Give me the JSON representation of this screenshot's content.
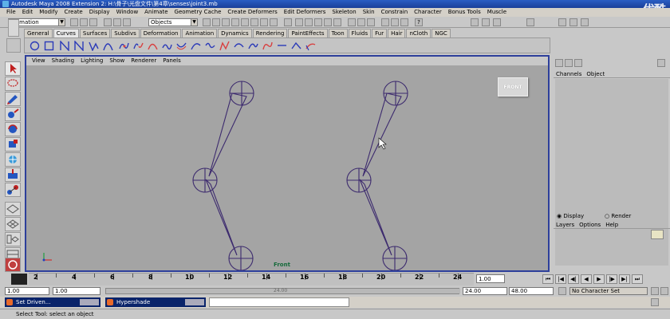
{
  "titlebar": {
    "title": "Autodesk Maya 2008 Extension 2: H:\\骨子\\光盘文件\\第4章\\senses\\joint3.mb",
    "logo": "优酷"
  },
  "menu": [
    "File",
    "Edit",
    "Modify",
    "Create",
    "Display",
    "Window",
    "Animate",
    "Geometry Cache",
    "Create Deformers",
    "Edit Deformers",
    "Skeleton",
    "Skin",
    "Constrain",
    "Character",
    "Bonus Tools",
    "Muscle"
  ],
  "statusline": {
    "mode": "Animation",
    "selection": "Objects"
  },
  "shelf_tabs": [
    "General",
    "Curves",
    "Surfaces",
    "Subdivs",
    "Deformation",
    "Animation",
    "Dynamics",
    "Rendering",
    "PaintEffects",
    "Toon",
    "Fluids",
    "Fur",
    "Hair",
    "nCloth",
    "NGC"
  ],
  "active_shelf_tab": "Curves",
  "panel_menu": [
    "View",
    "Shading",
    "Lighting",
    "Show",
    "Renderer",
    "Panels"
  ],
  "viewport": {
    "viewcube_label": "FRONT",
    "camera_label": "Front"
  },
  "channel_box": {
    "menu": [
      "Channels",
      "Object"
    ],
    "layer_radio": [
      "Display",
      "Render"
    ],
    "layer_menu": [
      "Layers",
      "Options",
      "Help"
    ]
  },
  "timeline": {
    "ticks": [
      "2",
      "4",
      "6",
      "8",
      "10",
      "12",
      "14",
      "16",
      "18",
      "20",
      "22",
      "24"
    ],
    "current_frame": "1.00"
  },
  "range": {
    "start": "1.00",
    "start2": "1.00",
    "end": "24.00",
    "end2": "48.00",
    "character_set": "No Character Set",
    "thumb_label": "24.00"
  },
  "taskbar": {
    "win1": "Set Driven...",
    "win2": "Hypershade"
  },
  "helpline": "Select Tool: select an object",
  "colors": {
    "viewport_bg": "#a4a4a4",
    "viewport_frame": "#2d3f9b",
    "joint": "#3c2a6e",
    "title_bar": "#1a3f9a"
  }
}
